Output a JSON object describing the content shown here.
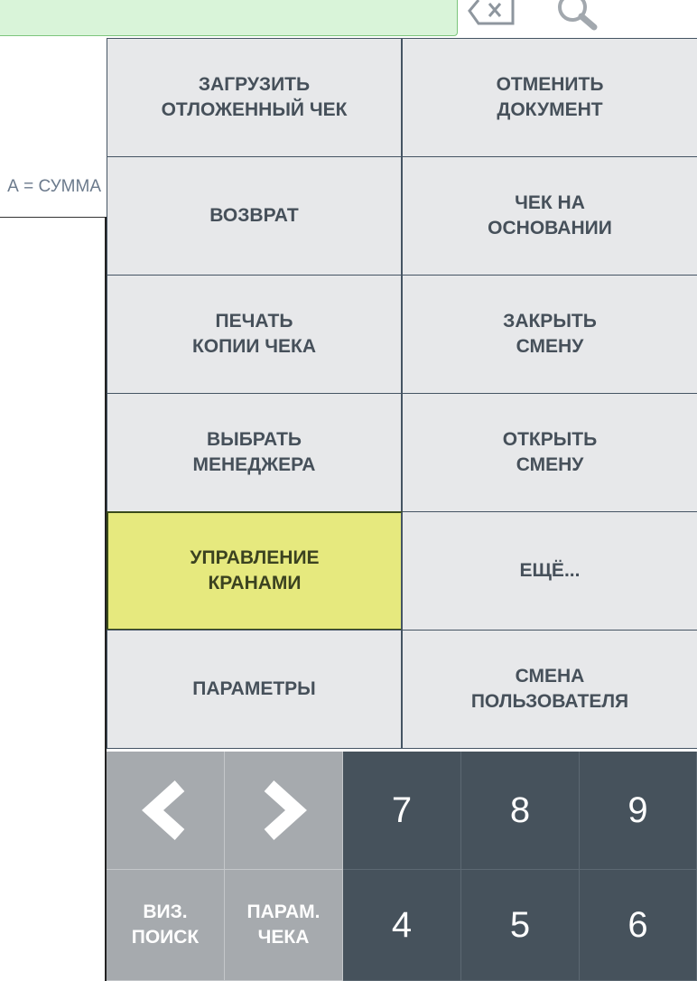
{
  "colors": {
    "search_bg": "#d9f4d9",
    "function_button_bg": "#e7e8ea",
    "function_button_text": "#46505a",
    "active_button_bg": "#e6e97e",
    "nav_key_bg": "#a6aaae",
    "digit_key_bg": "#46525c"
  },
  "header": {
    "clear_icon": "backspace-icon",
    "search_icon": "search-icon"
  },
  "receipt": {
    "formula_text": "А = СУММА"
  },
  "functions": {
    "load_deferred": "ЗАГРУЗИТЬ\nОТЛОЖЕННЫЙ ЧЕК",
    "cancel_document": "ОТМЕНИТЬ\nДОКУМЕНТ",
    "return": "ВОЗВРАТ",
    "receipt_based_on": "ЧЕК НА\nОСНОВАНИИ",
    "print_copy": "ПЕЧАТЬ\nКОПИИ ЧЕКА",
    "close_shift": "ЗАКРЫТЬ\nСМЕНУ",
    "select_manager": "ВЫБРАТЬ\nМЕНЕДЖЕРА",
    "open_shift": "ОТКРЫТЬ\nСМЕНУ",
    "tap_control": "УПРАВЛЕНИЕ\nКРАНАМИ",
    "more": "ЕЩЁ...",
    "parameters": "ПАРАМЕТРЫ",
    "change_user": "СМЕНА\nПОЛЬЗОВАТЕЛЯ"
  },
  "keypad": {
    "prev_icon": "chevron-left-icon",
    "next_icon": "chevron-right-icon",
    "visual_search": "ВИЗ.\nПОИСК",
    "receipt_params": "ПАРАМ.\nЧЕКА",
    "k7": "7",
    "k8": "8",
    "k9": "9",
    "k4": "4",
    "k5": "5",
    "k6": "6"
  }
}
